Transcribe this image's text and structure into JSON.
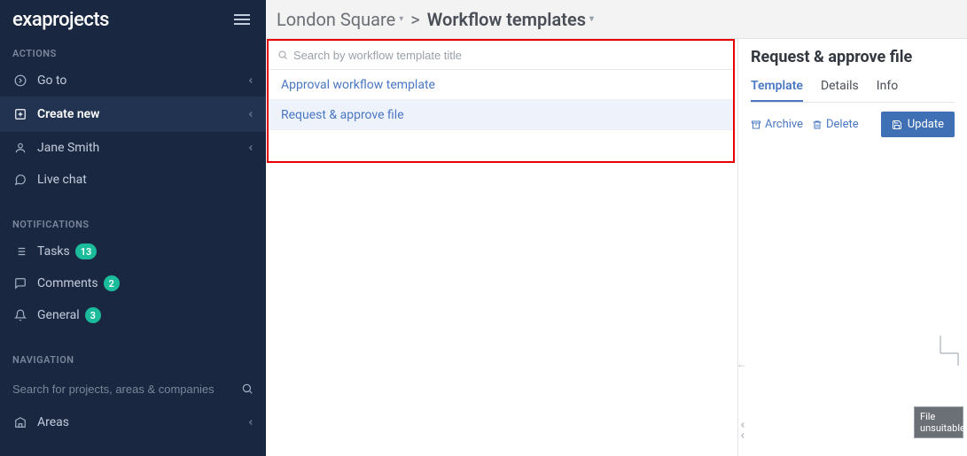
{
  "brand": "exaprojects",
  "sidebar": {
    "sections": {
      "actions": {
        "label": "ACTIONS"
      },
      "notifications": {
        "label": "NOTIFICATIONS"
      },
      "navigation": {
        "label": "NAVIGATION"
      }
    },
    "goto": "Go to",
    "create": "Create new",
    "user": "Jane Smith",
    "chat": "Live chat",
    "tasks": {
      "label": "Tasks",
      "count": "13"
    },
    "comments": {
      "label": "Comments",
      "count": "2"
    },
    "general": {
      "label": "General",
      "count": "3"
    },
    "searchPlaceholder": "Search for projects, areas & companies",
    "areas": "Areas"
  },
  "breadcrumb": {
    "project": "London Square",
    "sep": ">",
    "page": "Workflow templates"
  },
  "list": {
    "searchPlaceholder": "Search by workflow template title",
    "items": [
      {
        "title": "Approval workflow template"
      },
      {
        "title": "Request & approve file"
      }
    ]
  },
  "detail": {
    "title": "Request & approve file",
    "tabs": {
      "template": "Template",
      "details": "Details",
      "info": "Info"
    },
    "actions": {
      "archive": "Archive",
      "delete": "Delete",
      "update": "Update"
    },
    "node": {
      "line1": "File",
      "line2": "unsuitable"
    }
  }
}
